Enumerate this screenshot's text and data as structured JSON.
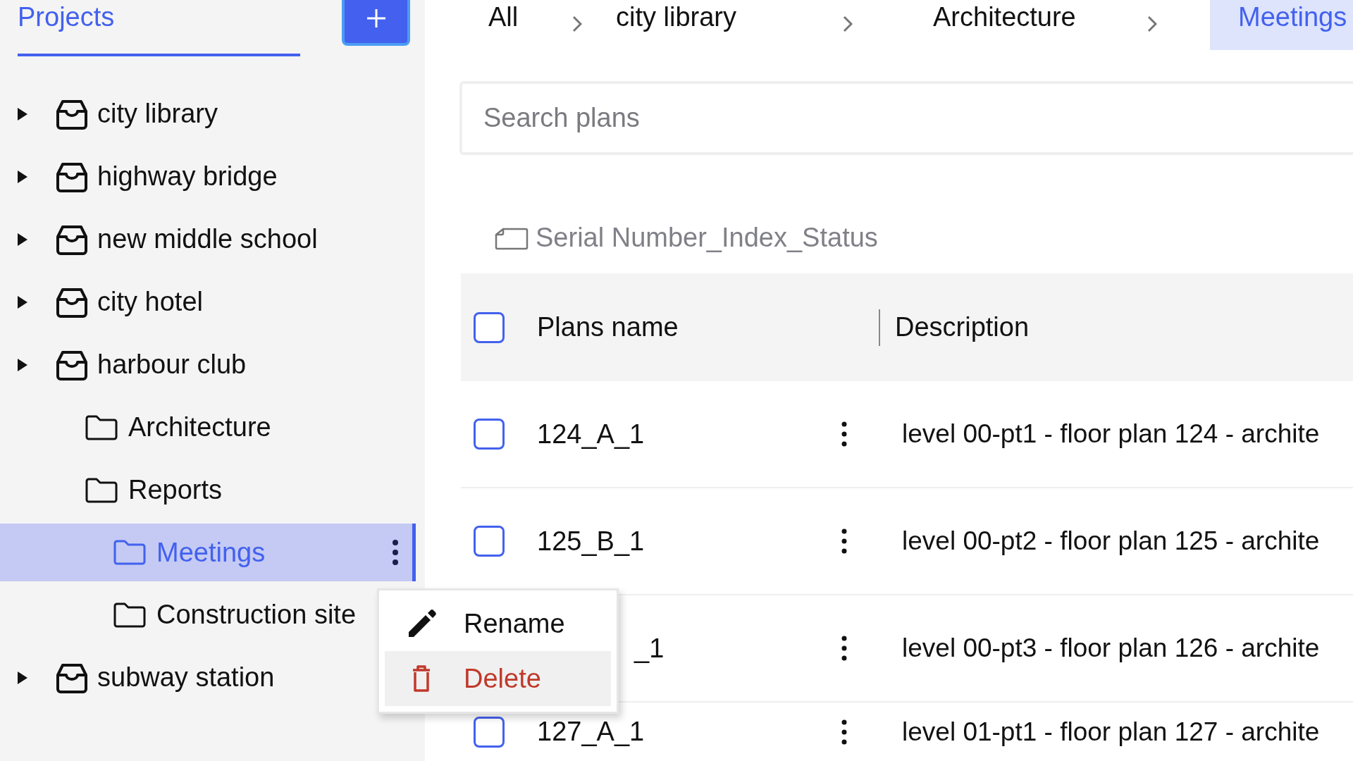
{
  "sidebar": {
    "tab": {
      "label": "Projects",
      "selected": true
    },
    "tree": [
      {
        "label": "city library",
        "kind": "project",
        "selected": false
      },
      {
        "label": "highway bridge",
        "kind": "project",
        "selected": false
      },
      {
        "label": "new middle school",
        "kind": "project",
        "selected": false
      },
      {
        "label": "city hotel",
        "kind": "project",
        "selected": false
      },
      {
        "label": "harbour club",
        "kind": "project",
        "selected": false,
        "children": [
          {
            "label": "Architecture",
            "kind": "folder",
            "selected": false
          },
          {
            "label": "Reports",
            "kind": "folder",
            "selected": false,
            "children": [
              {
                "label": "Meetings",
                "kind": "folder",
                "selected": true
              },
              {
                "label": "Construction site",
                "kind": "folder",
                "selected": false
              }
            ]
          }
        ]
      },
      {
        "label": "subway station",
        "kind": "project",
        "selected": false
      }
    ]
  },
  "breadcrumb": [
    {
      "label": "All",
      "selected": false
    },
    {
      "label": "city library",
      "selected": false
    },
    {
      "label": "Architecture",
      "selected": false
    },
    {
      "label": "Meetings",
      "selected": true
    }
  ],
  "search": {
    "placeholder": "Search plans"
  },
  "naming_hint": "Serial Number_Index_Status",
  "table": {
    "header_checked": false,
    "columns": [
      "Plans name",
      "Description"
    ],
    "rows": [
      {
        "name": "124_A_1",
        "description": "level 00-pt1 - floor plan 124 - archite",
        "checked": false
      },
      {
        "name": "125_B_1",
        "description": "level 00-pt2 - floor plan 125 - archite",
        "checked": false
      },
      {
        "name": "_1",
        "description": "level 00-pt3 - floor plan 126 - archite",
        "covered": true
      },
      {
        "name": "127_A_1",
        "description": "level 01-pt1 - floor plan 127 - archite",
        "checked": false
      }
    ]
  },
  "context_menu": [
    {
      "label": "Rename",
      "kind": "rename",
      "selected": false
    },
    {
      "label": "Delete",
      "kind": "delete",
      "selected": true
    }
  ]
}
